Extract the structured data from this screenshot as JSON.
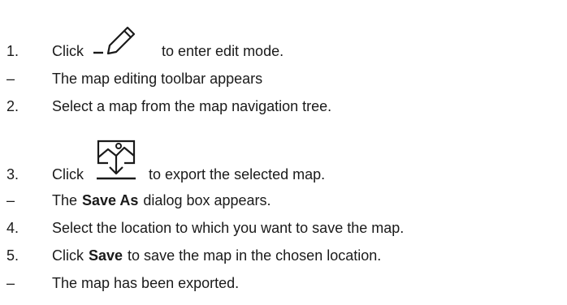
{
  "steps": [
    {
      "marker": "1.",
      "before": "Click",
      "icon": "edit-pencil-icon",
      "after": "to enter edit mode."
    },
    {
      "marker": "–",
      "text": "The map editing toolbar appears"
    },
    {
      "marker": "2.",
      "text": "Select a map from the map navigation tree."
    },
    {
      "marker": "3.",
      "before": "Click",
      "icon": "export-map-icon",
      "after": "to export the selected map."
    },
    {
      "marker": "–",
      "before": "The",
      "bold": "Save As",
      "after": "dialog box appears."
    },
    {
      "marker": "4.",
      "text": "Select the location to which you want to save the map."
    },
    {
      "marker": "5.",
      "before": "Click",
      "bold": "Save",
      "after": "to save the map in the chosen location."
    },
    {
      "marker": "–",
      "text": "The map has been exported."
    }
  ]
}
